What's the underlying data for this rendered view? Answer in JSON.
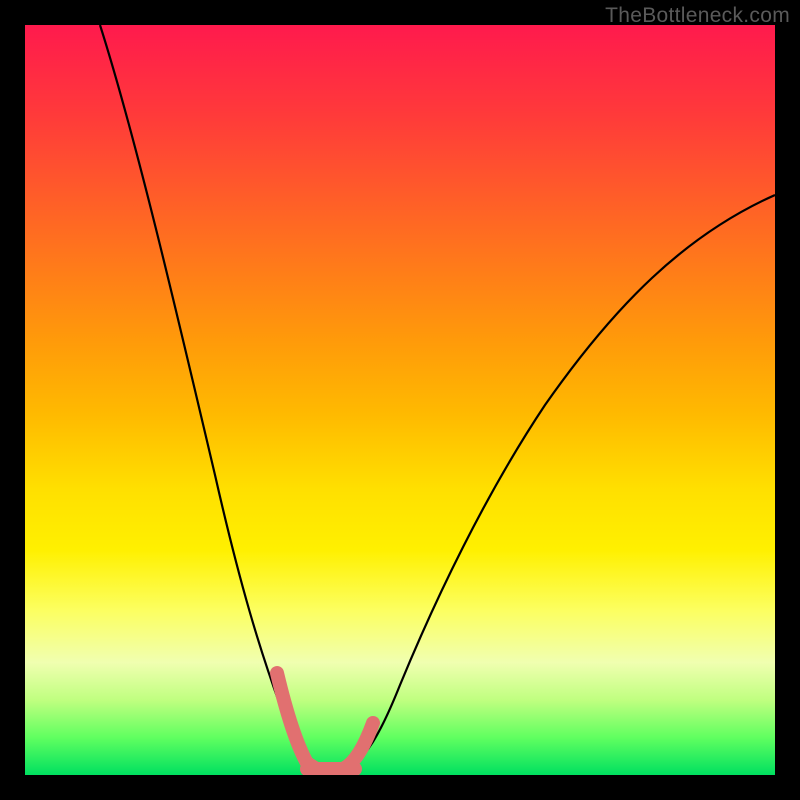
{
  "watermark": "TheBottleneck.com",
  "chart_data": {
    "type": "line",
    "title": "",
    "xlabel": "",
    "ylabel": "",
    "xlim": [
      0,
      100
    ],
    "ylim": [
      0,
      100
    ],
    "background_gradient": [
      "#ff1a4d",
      "#ffe000",
      "#00e060"
    ],
    "series": [
      {
        "name": "left-curve",
        "x": [
          10,
          14,
          18,
          22,
          26,
          28,
          30,
          32,
          34,
          35,
          36,
          37,
          38,
          39
        ],
        "y": [
          100,
          88,
          74,
          60,
          44,
          36,
          27,
          18,
          9,
          6,
          4,
          3,
          2,
          2
        ]
      },
      {
        "name": "right-curve",
        "x": [
          39,
          40,
          42,
          44,
          46,
          50,
          55,
          60,
          65,
          70,
          75,
          80,
          85,
          90,
          95,
          100
        ],
        "y": [
          2,
          2,
          3,
          5,
          8,
          14,
          22,
          30,
          37,
          44,
          50,
          56,
          62,
          67,
          72,
          77
        ]
      },
      {
        "name": "pink-highlight-segment",
        "x": [
          33,
          34,
          35,
          36,
          37,
          38,
          39,
          40,
          41,
          42,
          43,
          44
        ],
        "y": [
          14,
          9,
          6,
          4,
          3,
          2,
          2,
          2,
          2,
          3,
          4,
          6
        ]
      }
    ]
  }
}
